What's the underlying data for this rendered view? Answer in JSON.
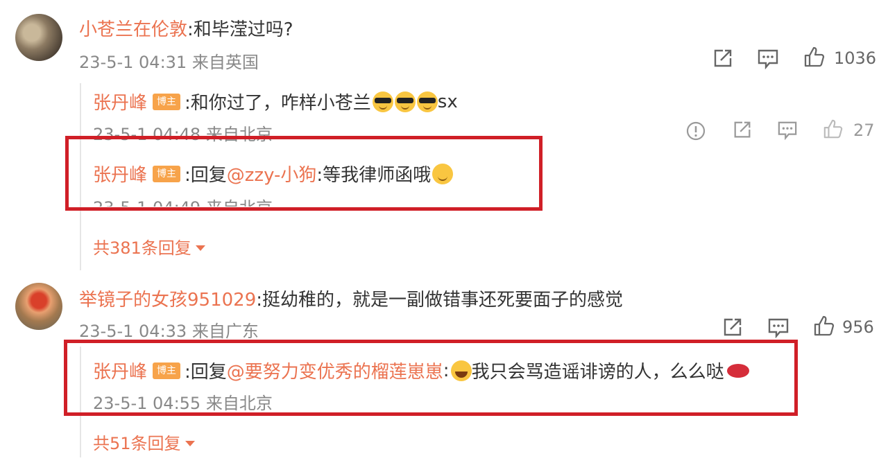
{
  "comments": [
    {
      "user": "小苍兰在伦敦",
      "text": ":和毕滢过吗?",
      "meta": "23-5-1 04:31 来自英国",
      "likes": "1036",
      "replies": [
        {
          "user": "张丹峰",
          "badge": "博主",
          "text": ":和你过了，咋样小苍兰",
          "emoji_suffix": "sx",
          "meta": "23-5-1 04:48 来自北京",
          "likes": "27"
        },
        {
          "user": "张丹峰",
          "badge": "博主",
          "reply_prefix": ":回复",
          "mention": "@zzy-小狗",
          "text": ":等我律师函哦",
          "meta": "23-5-1 04:49 来自北京"
        }
      ],
      "more": "共381条回复"
    },
    {
      "user": "举镜子的女孩951029",
      "text": ":挺幼稚的，就是一副做错事还死要面子的感觉",
      "meta": "23-5-1 04:33 来自广东",
      "likes": "956",
      "replies": [
        {
          "user": "张丹峰",
          "badge": "博主",
          "reply_prefix": ":回复",
          "mention": "@要努力变优秀的榴莲崽崽",
          "text": "我只会骂造谣诽谤的人，么么哒",
          "meta": "23-5-1 04:55 来自北京"
        }
      ],
      "more": "共51条回复"
    }
  ],
  "icons": [
    "share-icon",
    "comment-icon",
    "like-icon",
    "report-icon",
    "emoji-cool",
    "emoji-smirk",
    "emoji-laugh",
    "lips-emoji"
  ],
  "colors": {
    "username": "#eb7350",
    "badge": "#f7a34a",
    "highlight_box": "#d01f27",
    "meta": "#888888"
  }
}
